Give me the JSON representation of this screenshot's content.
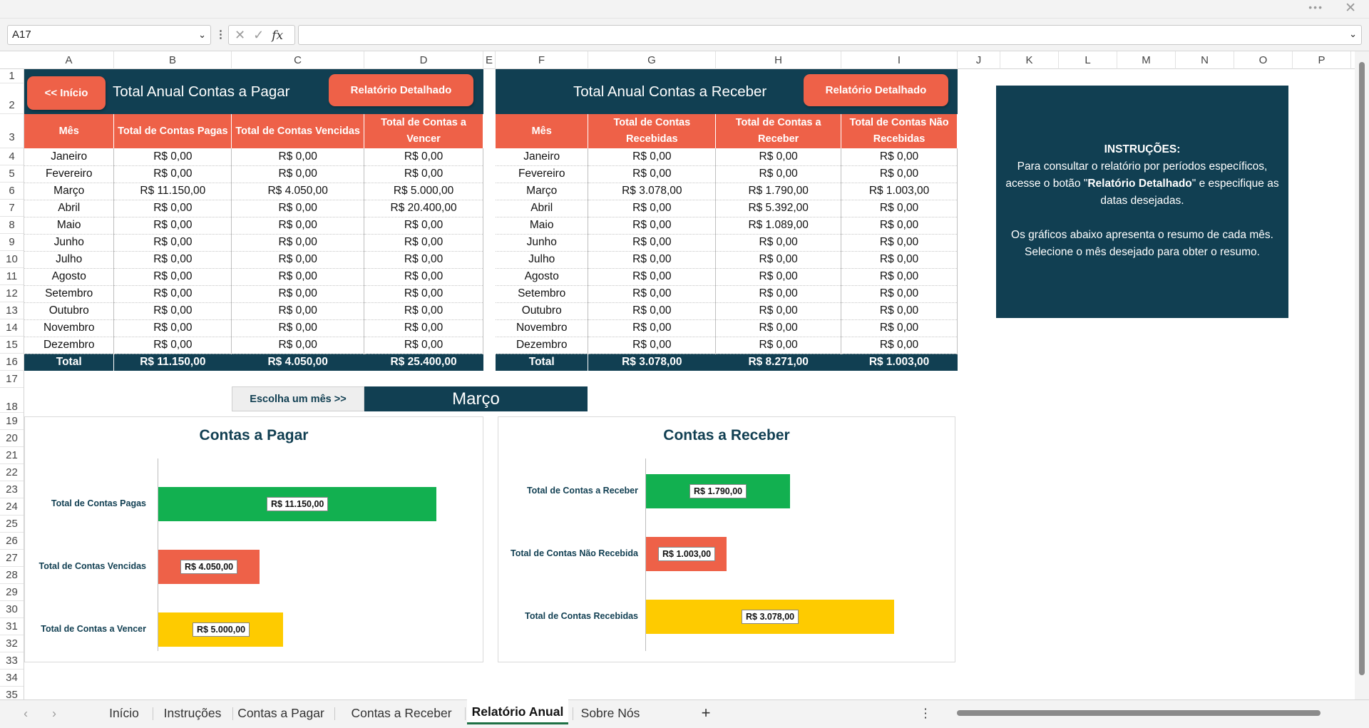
{
  "name_box": "A17",
  "formula_value": "",
  "columns": [
    "A",
    "B",
    "C",
    "D",
    "E",
    "F",
    "G",
    "H",
    "I",
    "J",
    "K",
    "L",
    "M",
    "N",
    "O",
    "P"
  ],
  "rows": [
    "1",
    "2",
    "3",
    "4",
    "5",
    "6",
    "7",
    "8",
    "9",
    "10",
    "11",
    "12",
    "13",
    "14",
    "15",
    "16",
    "17",
    "18",
    "19",
    "20",
    "21",
    "22",
    "23",
    "24",
    "25",
    "26",
    "27",
    "28",
    "29",
    "30",
    "31",
    "32",
    "33",
    "34",
    "35"
  ],
  "pagar": {
    "inicio_button": "<< Início",
    "title": "Total Anual Contas a Pagar",
    "detail_button": "Relatório Detalhado",
    "headers": [
      "Mês",
      "Total de Contas Pagas",
      "Total de Contas Vencidas",
      "Total de Contas a Vencer"
    ],
    "rows": [
      [
        "Janeiro",
        "R$ 0,00",
        "R$ 0,00",
        "R$ 0,00"
      ],
      [
        "Fevereiro",
        "R$ 0,00",
        "R$ 0,00",
        "R$ 0,00"
      ],
      [
        "Março",
        "R$ 11.150,00",
        "R$ 4.050,00",
        "R$ 5.000,00"
      ],
      [
        "Abril",
        "R$ 0,00",
        "R$ 0,00",
        "R$ 20.400,00"
      ],
      [
        "Maio",
        "R$ 0,00",
        "R$ 0,00",
        "R$ 0,00"
      ],
      [
        "Junho",
        "R$ 0,00",
        "R$ 0,00",
        "R$ 0,00"
      ],
      [
        "Julho",
        "R$ 0,00",
        "R$ 0,00",
        "R$ 0,00"
      ],
      [
        "Agosto",
        "R$ 0,00",
        "R$ 0,00",
        "R$ 0,00"
      ],
      [
        "Setembro",
        "R$ 0,00",
        "R$ 0,00",
        "R$ 0,00"
      ],
      [
        "Outubro",
        "R$ 0,00",
        "R$ 0,00",
        "R$ 0,00"
      ],
      [
        "Novembro",
        "R$ 0,00",
        "R$ 0,00",
        "R$ 0,00"
      ],
      [
        "Dezembro",
        "R$ 0,00",
        "R$ 0,00",
        "R$ 0,00"
      ]
    ],
    "total": [
      "Total",
      "R$ 11.150,00",
      "R$ 4.050,00",
      "R$ 25.400,00"
    ]
  },
  "receber": {
    "title": "Total Anual Contas a Receber",
    "detail_button": "Relatório Detalhado",
    "headers": [
      "Mês",
      "Total de Contas Recebidas",
      "Total de Contas a Receber",
      "Total de Contas Não Recebidas"
    ],
    "rows": [
      [
        "Janeiro",
        "R$ 0,00",
        "R$ 0,00",
        "R$ 0,00"
      ],
      [
        "Fevereiro",
        "R$ 0,00",
        "R$ 0,00",
        "R$ 0,00"
      ],
      [
        "Março",
        "R$ 3.078,00",
        "R$ 1.790,00",
        "R$ 1.003,00"
      ],
      [
        "Abril",
        "R$ 0,00",
        "R$ 5.392,00",
        "R$ 0,00"
      ],
      [
        "Maio",
        "R$ 0,00",
        "R$ 1.089,00",
        "R$ 0,00"
      ],
      [
        "Junho",
        "R$ 0,00",
        "R$ 0,00",
        "R$ 0,00"
      ],
      [
        "Julho",
        "R$ 0,00",
        "R$ 0,00",
        "R$ 0,00"
      ],
      [
        "Agosto",
        "R$ 0,00",
        "R$ 0,00",
        "R$ 0,00"
      ],
      [
        "Setembro",
        "R$ 0,00",
        "R$ 0,00",
        "R$ 0,00"
      ],
      [
        "Outubro",
        "R$ 0,00",
        "R$ 0,00",
        "R$ 0,00"
      ],
      [
        "Novembro",
        "R$ 0,00",
        "R$ 0,00",
        "R$ 0,00"
      ],
      [
        "Dezembro",
        "R$ 0,00",
        "R$ 0,00",
        "R$ 0,00"
      ]
    ],
    "total": [
      "Total",
      "R$ 3.078,00",
      "R$ 8.271,00",
      "R$ 1.003,00"
    ]
  },
  "instructions": {
    "heading": "INSTRUÇÕES:",
    "line1": "Para consultar o relatório por períodos específicos,",
    "line2_pre": "acesse o botão \"",
    "line2_bold": "Relatório Detalhado",
    "line2_post": "\" e especifique as",
    "line3": "datas desejadas.",
    "line4": "Os gráficos abaixo apresenta o resumo de cada mês.",
    "line5": "Selecione o mês desejado para obter o resumo."
  },
  "month_picker": {
    "label": "Escolha um mês >>",
    "value": "Março"
  },
  "colors": {
    "dark": "#113f52",
    "orange": "#ee6148",
    "green": "#12b050",
    "red": "#ee6148",
    "yellow": "#fecb00"
  },
  "chart_data": [
    {
      "type": "bar",
      "orientation": "horizontal",
      "title": "Contas a Pagar",
      "categories": [
        "Total de Contas Pagas",
        "Total de Contas Vencidas",
        "Total de Contas a Vencer"
      ],
      "values": [
        11150,
        4050,
        5000
      ],
      "labels": [
        "R$ 11.150,00",
        "R$ 4.050,00",
        "R$ 5.000,00"
      ],
      "colors": [
        "#12b050",
        "#ee6148",
        "#fecb00"
      ],
      "xlim": [
        0,
        12000
      ],
      "grid": false
    },
    {
      "type": "bar",
      "orientation": "horizontal",
      "title": "Contas a Receber",
      "categories": [
        "Total de Contas a Receber",
        "Total de Contas Não Recebida",
        "Total de Contas Recebidas"
      ],
      "values": [
        1790,
        1003,
        3078
      ],
      "labels": [
        "R$ 1.790,00",
        "R$ 1.003,00",
        "R$ 3.078,00"
      ],
      "colors": [
        "#12b050",
        "#ee6148",
        "#fecb00"
      ],
      "xlim": [
        0,
        3200
      ],
      "grid": false
    }
  ],
  "sheet_tabs": [
    "Início",
    "Instruções",
    "Contas a Pagar",
    "Contas a Receber",
    "Relatório Anual",
    "Sobre Nós"
  ],
  "active_tab": "Relatório Anual",
  "icons": {
    "prev": "chevron-left-icon",
    "next": "chevron-right-icon",
    "add": "plus-icon"
  }
}
